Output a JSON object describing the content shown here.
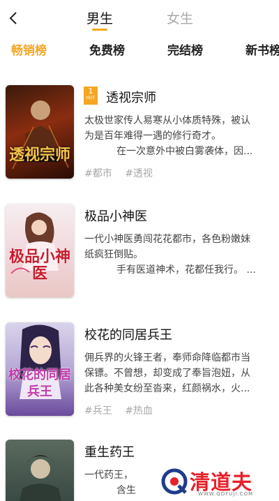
{
  "header": {
    "back_icon": "chevron-left-icon",
    "tabs": [
      {
        "label": "男生",
        "active": true
      },
      {
        "label": "女生",
        "active": false
      }
    ],
    "accent_color": "#f5a623"
  },
  "category_tabs": [
    {
      "label": "畅销榜",
      "active": true
    },
    {
      "label": "免费榜",
      "active": false
    },
    {
      "label": "完结榜",
      "active": false
    },
    {
      "label": "新书榜",
      "active": false
    }
  ],
  "books": [
    {
      "title": "透视宗师",
      "cover_title": "透视宗师",
      "rank_badge": {
        "number": "1",
        "label": "HOT"
      },
      "desc_lines": [
        "太极世家传人易寒从小体质特殊，被认",
        "为是百年难得一遇的修行奇才。",
        "在一次意外中被白雾袭体，因..."
      ],
      "tags": [
        "#都市",
        "#透视"
      ]
    },
    {
      "title": "极品小神医",
      "cover_title": "极品小神医",
      "desc_lines": [
        "一代小神医勇闯花花都市，各色粉嫩妹",
        "纸疯狂倒贴。",
        "手有医道神术，花都任我行。 ..."
      ],
      "tags": []
    },
    {
      "title": "校花的同居兵王",
      "cover_title": "校花的同居兵王",
      "desc_lines": [
        "佣兵界的火锋王者，奉师命降临都市当",
        "保镖。不曾想，却变成了奉旨泡妞，从",
        "此各种美女纷至沓来，红颜祸水，火..."
      ],
      "tags": [
        "#兵王",
        "#热血"
      ]
    },
    {
      "title": "重生药王",
      "cover_title": "",
      "desc_lines": [
        "一代药王，",
        "含生"
      ],
      "tags": []
    }
  ],
  "watermark": {
    "text": "清道夫",
    "url": "WWW.QDFUJI.COM"
  }
}
